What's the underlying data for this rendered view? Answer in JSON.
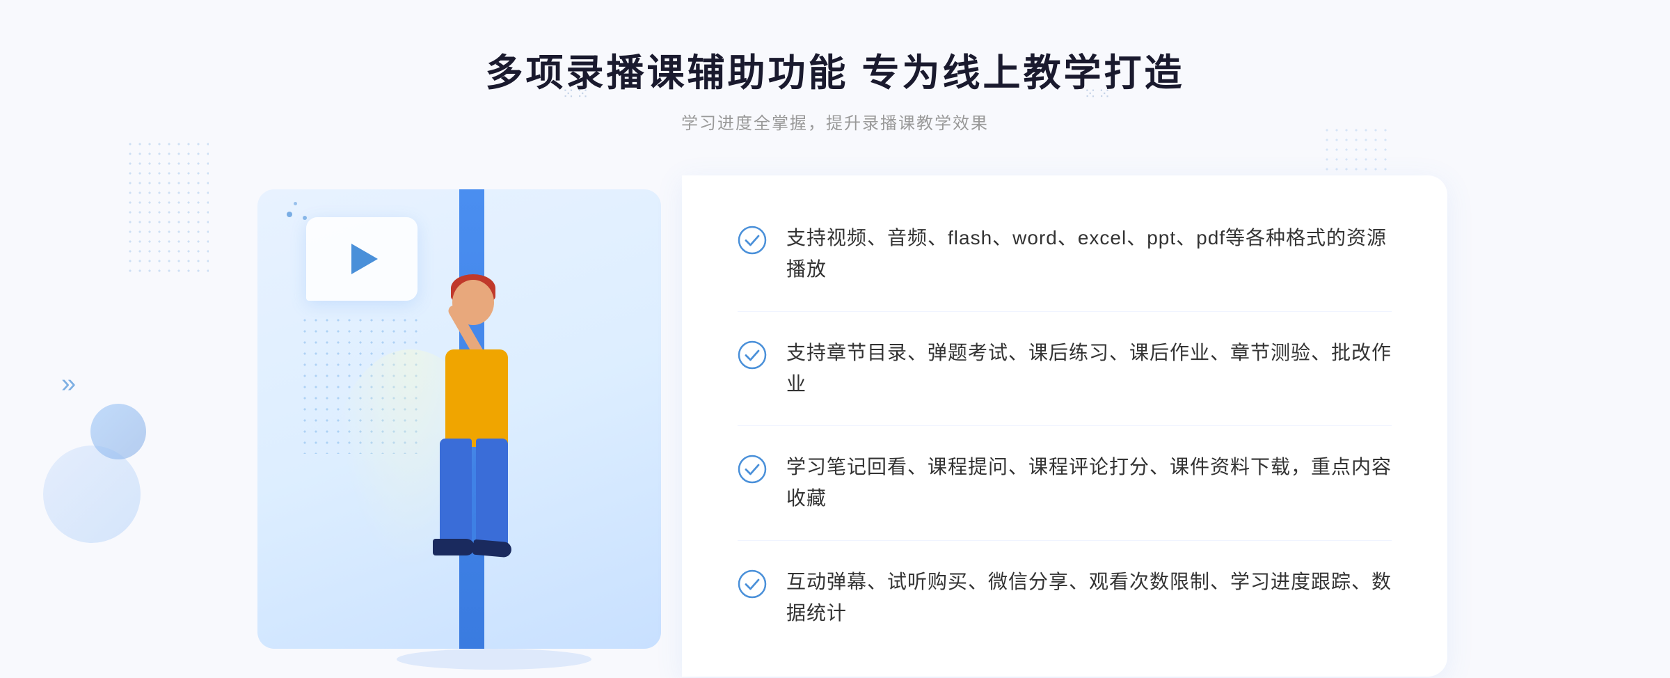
{
  "header": {
    "title": "多项录播课辅助功能 专为线上教学打造",
    "subtitle": "学习进度全掌握，提升录播课教学效果",
    "chevron_left": "❖",
    "chevron_right": "❖"
  },
  "features": [
    {
      "id": "feature-1",
      "text": "支持视频、音频、flash、word、excel、ppt、pdf等各种格式的资源播放"
    },
    {
      "id": "feature-2",
      "text": "支持章节目录、弹题考试、课后练习、课后作业、章节测验、批改作业"
    },
    {
      "id": "feature-3",
      "text": "学习笔记回看、课程提问、课程评论打分、课件资料下载，重点内容收藏"
    },
    {
      "id": "feature-4",
      "text": "互动弹幕、试听购买、微信分享、观看次数限制、学习进度跟踪、数据统计"
    }
  ],
  "decorations": {
    "arrow_left": "»",
    "play_label": "play"
  }
}
